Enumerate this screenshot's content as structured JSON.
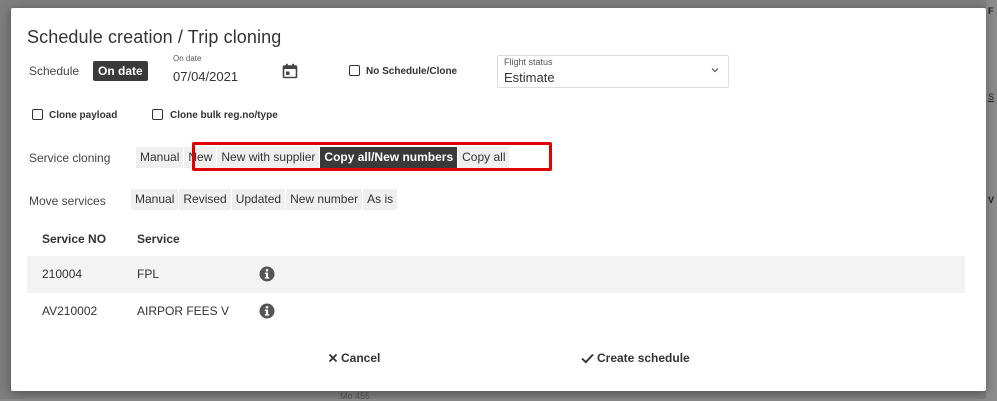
{
  "dialog": {
    "title": "Schedule creation / Trip cloning"
  },
  "schedule": {
    "label": "Schedule",
    "mode": "On date",
    "date_label": "On date",
    "date_value": "07/04/2021",
    "no_schedule_label": "No Schedule/Clone"
  },
  "flight_status": {
    "label": "Flight status",
    "value": "Estimate"
  },
  "clone_options": {
    "clone_payload": "Clone payload",
    "clone_bulk": "Clone bulk reg.no/type"
  },
  "service_cloning": {
    "label": "Service cloning",
    "options": [
      "Manual",
      "New",
      "New with supplier",
      "Copy all/New numbers",
      "Copy all"
    ],
    "selected": "Copy all/New numbers"
  },
  "move_services": {
    "label": "Move services",
    "options": [
      "Manual",
      "Revised",
      "Updated",
      "New number",
      "As is"
    ]
  },
  "table": {
    "headers": [
      "Service NO",
      "Service"
    ],
    "rows": [
      {
        "service_no": "210004",
        "service": "FPL"
      },
      {
        "service_no": "AV210002",
        "service": "AIRPOR FEES V"
      }
    ]
  },
  "footer": {
    "cancel": "Cancel",
    "create": "Create schedule"
  },
  "background": {
    "bottom_fragment": "Mo 455"
  },
  "colors": {
    "active": "#3a3a3a",
    "highlight": "#e00000"
  },
  "icons": {
    "calendar": "calendar-icon",
    "chevron": "chevron-down-icon",
    "info": "info-icon",
    "cancel": "close-icon",
    "create": "check-icon"
  }
}
